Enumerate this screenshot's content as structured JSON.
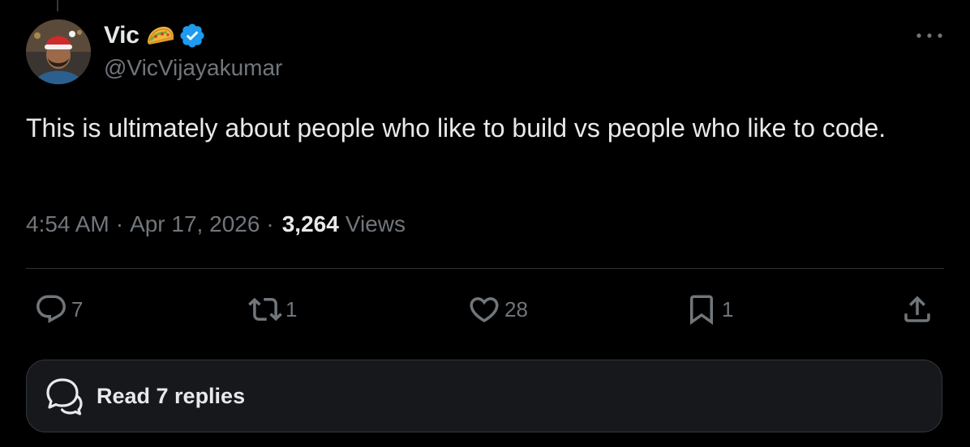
{
  "author": {
    "display_name": "Vic",
    "handle": "@VicVijayakumar",
    "emoji_icon": "taco-icon",
    "verified_icon": "verified-badge-icon"
  },
  "tweet": {
    "text": "This is ultimately about people who like to build vs people who like to code."
  },
  "meta": {
    "time": "4:54 AM",
    "separator": "·",
    "date": "Apr 17, 2026",
    "views_count": "3,264",
    "views_label": "Views"
  },
  "actions": {
    "replies": "7",
    "reposts": "1",
    "likes": "28",
    "bookmarks": "1"
  },
  "read_replies": {
    "label": "Read 7 replies"
  },
  "colors": {
    "background": "#000000",
    "text": "#e7e9ea",
    "muted": "#71767b",
    "verified": "#1d9bf0"
  }
}
